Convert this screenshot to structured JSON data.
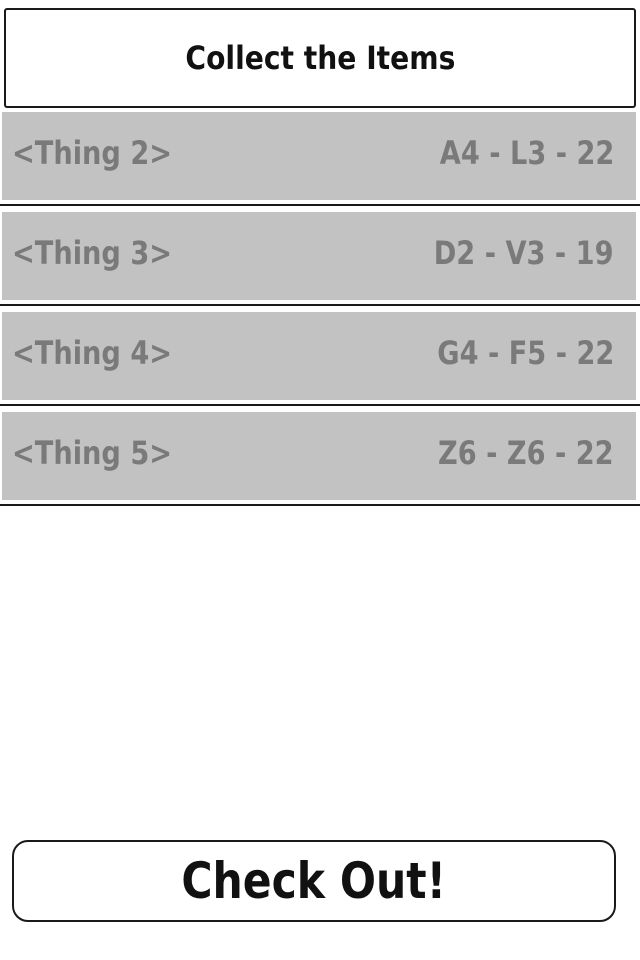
{
  "header": {
    "title": "Collect the Items"
  },
  "items": [
    {
      "name": "<Thing 2>",
      "code": "A4 - L3 - 22"
    },
    {
      "name": "<Thing 3>",
      "code": "D2 - V3 - 19"
    },
    {
      "name": "<Thing 4>",
      "code": "G4 - F5 - 22"
    },
    {
      "name": "<Thing 5>",
      "code": "Z6 - Z6 - 22"
    }
  ],
  "checkout": {
    "label": "Check Out!"
  },
  "colors": {
    "row_background": "#c2c2c2",
    "row_text": "#7a7a7a",
    "border": "#1a1a1a"
  }
}
